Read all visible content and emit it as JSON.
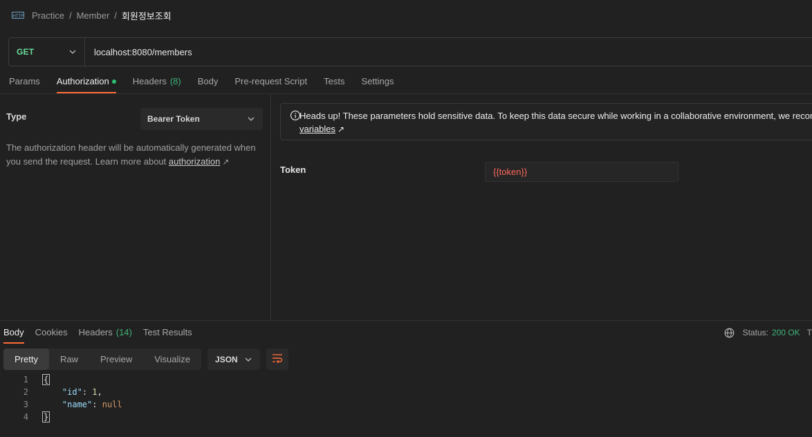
{
  "breadcrumb": {
    "icon": "http-icon",
    "items": [
      "Practice",
      "Member"
    ],
    "separator": "/",
    "current": "회원정보조회"
  },
  "request": {
    "method": "GET",
    "url": "localhost:8080/members"
  },
  "request_tabs": [
    {
      "label": "Params"
    },
    {
      "label": "Authorization",
      "active": true,
      "indicator": "green-dot"
    },
    {
      "label": "Headers",
      "count": "(8)"
    },
    {
      "label": "Body"
    },
    {
      "label": "Pre-request Script"
    },
    {
      "label": "Tests"
    },
    {
      "label": "Settings"
    }
  ],
  "auth": {
    "type_label": "Type",
    "type_value": "Bearer Token",
    "desc_prefix": "The authorization header will be automatically generated when you send the request. Learn more about ",
    "desc_link": "authorization",
    "desc_link_arrow": "↗",
    "banner_line1": "Heads up! These parameters hold sensitive data. To keep this data secure while working in a collaborative environment, we recomm",
    "banner_link": "variables",
    "banner_link_arrow": "↗",
    "token_label": "Token",
    "token_value": "{{token}}"
  },
  "response_tabs": [
    {
      "label": "Body",
      "active": true
    },
    {
      "label": "Cookies"
    },
    {
      "label": "Headers",
      "count": "(14)"
    },
    {
      "label": "Test Results"
    }
  ],
  "response_status": {
    "label": "Status:",
    "value": "200 OK",
    "truncated": "T"
  },
  "view_modes": [
    {
      "label": "Pretty",
      "active": true
    },
    {
      "label": "Raw"
    },
    {
      "label": "Preview"
    },
    {
      "label": "Visualize"
    }
  ],
  "format": "JSON",
  "body_lines": [
    {
      "n": "1"
    },
    {
      "n": "2",
      "key": "\"id\"",
      "colon": ": ",
      "value": "1",
      "suffix": ","
    },
    {
      "n": "3",
      "key": "\"name\"",
      "colon": ": ",
      "value": "null",
      "suffix": ""
    },
    {
      "n": "4"
    }
  ],
  "body_open": "{",
  "body_close": "}",
  "colors": {
    "accent": "#ff6c37",
    "method_get": "#6bdd9a",
    "status_ok": "#3fb57a",
    "token_var": "#ff6a5c"
  }
}
